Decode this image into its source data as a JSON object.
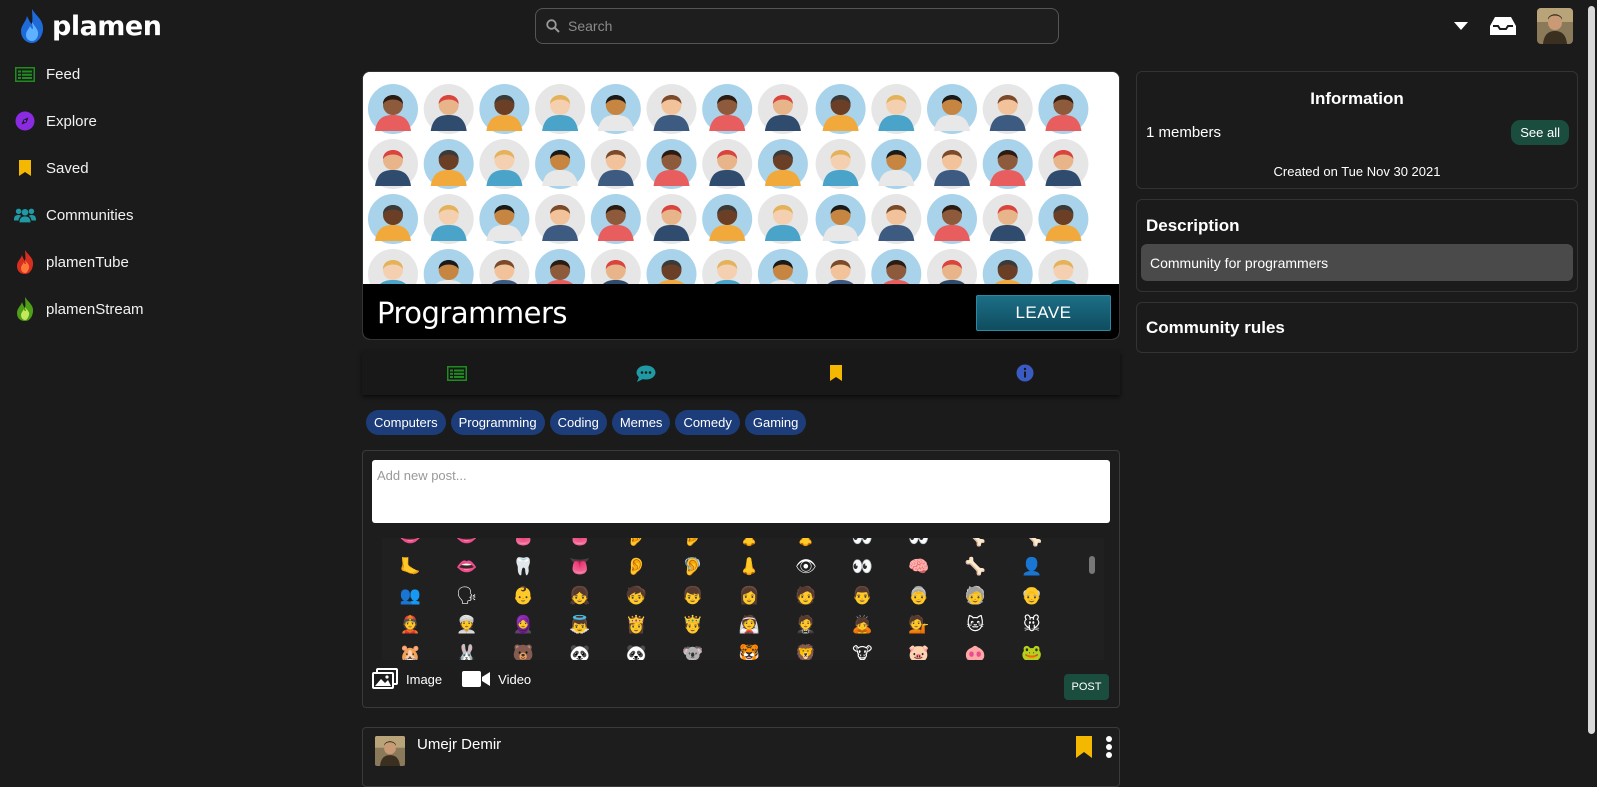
{
  "app": {
    "name": "plamen",
    "logo_icon": "blue-flame-icon"
  },
  "search": {
    "placeholder": "Search",
    "icon": "search-icon"
  },
  "topbar": {
    "icons": [
      "caret-down-icon",
      "inbox-icon",
      "user-avatar"
    ]
  },
  "sidebar": {
    "items": [
      {
        "label": "Feed",
        "icon": "feed-icon",
        "color": "#1e8c1e"
      },
      {
        "label": "Explore",
        "icon": "compass-icon",
        "color": "#8a2be2"
      },
      {
        "label": "Saved",
        "icon": "bookmark-icon",
        "color": "#f5b800"
      },
      {
        "label": "Communities",
        "icon": "users-icon",
        "color": "#1f9aa5"
      },
      {
        "label": "plamenTube",
        "icon": "red-flame-icon",
        "color": "#e0302a"
      },
      {
        "label": "plamenStream",
        "icon": "green-flame-icon",
        "color": "#6cc324"
      }
    ]
  },
  "community": {
    "name": "Programmers",
    "leave_label": "LEAVE"
  },
  "tabs": [
    {
      "icon": "feed-icon",
      "color": "#1e8c1e"
    },
    {
      "icon": "chat-icon",
      "color": "#1f9aa5"
    },
    {
      "icon": "bookmark-icon",
      "color": "#f5b800"
    },
    {
      "icon": "info-icon",
      "color": "#3b5bc4"
    }
  ],
  "tags": [
    "Computers",
    "Programming",
    "Coding",
    "Memes",
    "Comedy",
    "Gaming"
  ],
  "composer": {
    "placeholder": "Add new post...",
    "image_label": "Image",
    "video_label": "Video",
    "post_label": "POST",
    "emojis": [
      "👄",
      "👄",
      "👅",
      "👅",
      "👂",
      "👂",
      "👃",
      "👃",
      "👀",
      "👀",
      "🦴",
      "🦴",
      "🦶",
      "👄",
      "🦷",
      "👅",
      "👂",
      "🦻",
      "👃",
      "👁",
      "👀",
      "🧠",
      "🦴",
      "👤",
      "👥",
      "🗣",
      "👶",
      "👧",
      "🧒",
      "👦",
      "👩",
      "🧑",
      "👨",
      "👵",
      "🧓",
      "👴",
      "👲",
      "👳",
      "🧕",
      "👼",
      "👸",
      "🤴",
      "👰",
      "🤵",
      "🙇",
      "💁",
      "🐱",
      "🐭",
      "🐹",
      "🐰",
      "🐻",
      "🐼",
      "🐼",
      "🐨",
      "🐯",
      "🦁",
      "🐮",
      "🐷",
      "🐽",
      "🐸"
    ]
  },
  "post": {
    "author": "Umejr Demir"
  },
  "info_panel": {
    "title": "Information",
    "members": "1 members",
    "see_all": "See all",
    "created": "Created on Tue Nov 30 2021"
  },
  "description_panel": {
    "title": "Description",
    "text": "Community for programmers"
  },
  "rules_panel": {
    "title": "Community rules"
  }
}
